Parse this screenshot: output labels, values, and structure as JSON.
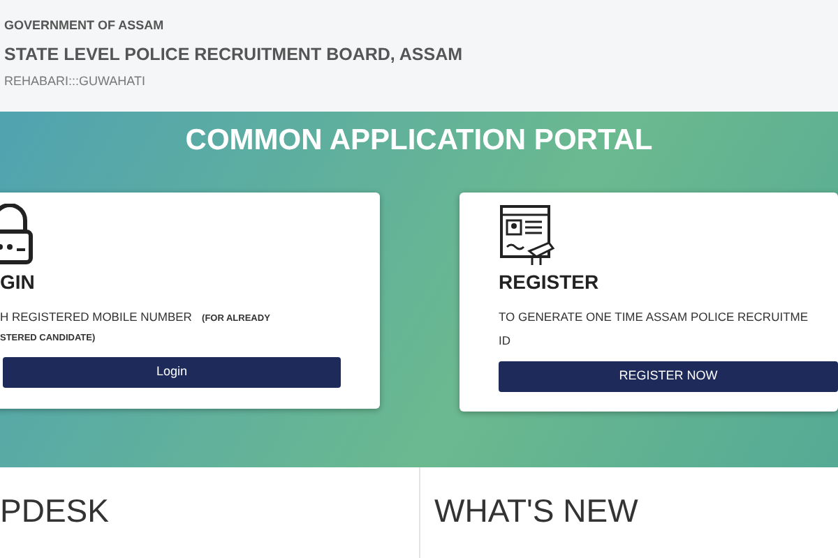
{
  "header": {
    "government": "GOVERNMENT OF ASSAM",
    "board": "STATE LEVEL POLICE RECRUITMENT BOARD, ASSAM",
    "location": "REHABARI:::GUWAHATI"
  },
  "portal_title": "COMMON APPLICATION PORTAL",
  "cards": [
    {
      "kind": "login",
      "title": "GIN",
      "description": "H REGISTERED MOBILE NUMBER",
      "note": "(FOR ALREADY",
      "note_cont": "STERED CANDIDATE)",
      "button": "Login"
    },
    {
      "kind": "register",
      "title": "REGISTER",
      "description": "TO GENERATE ONE TIME ASSAM POLICE RECRUITME",
      "description_cont": "ID",
      "button": "REGISTER NOW"
    }
  ],
  "sections": [
    "PDESK",
    "WHAT'S NEW"
  ]
}
